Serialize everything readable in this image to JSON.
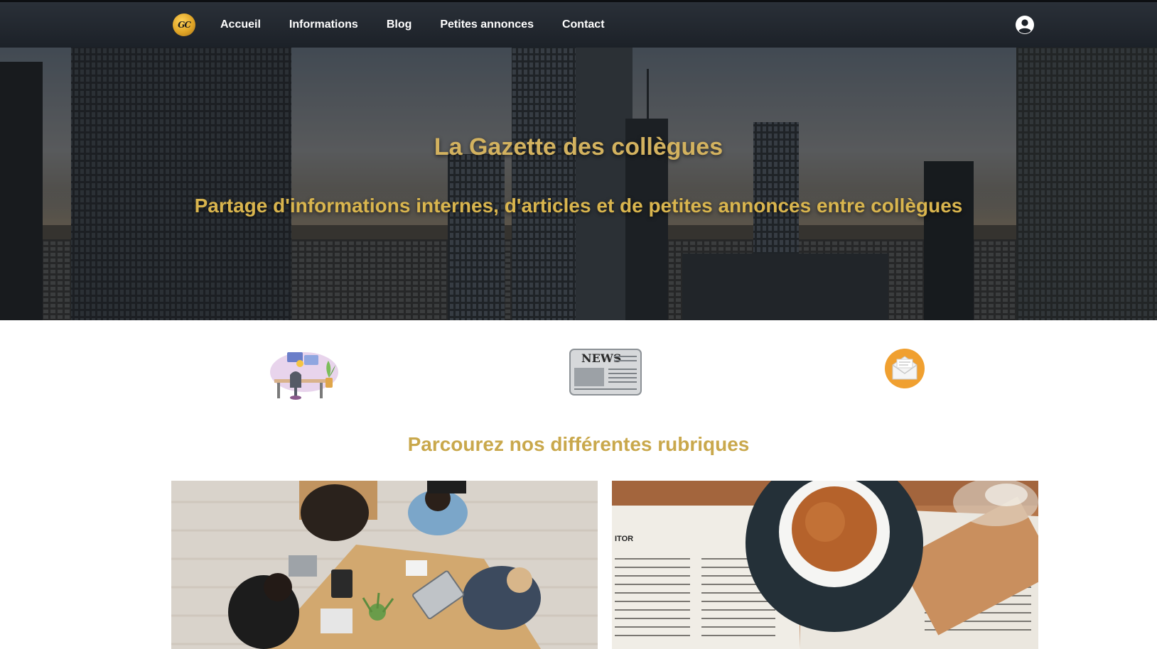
{
  "nav": {
    "logo_text": "GC",
    "links": [
      "Accueil",
      "Informations",
      "Blog",
      "Petites annonces",
      "Contact"
    ],
    "user_icon": "user-circle-icon"
  },
  "hero": {
    "title": "La Gazette des collègues",
    "subtitle": "Partage d'informations internes, d'articles et de petites annonces entre collègues"
  },
  "features": {
    "icons": [
      "office-desk-icon",
      "newspaper-icon",
      "envelope-icon"
    ],
    "news_label": "NEWS"
  },
  "rubriques": {
    "title": "Parcourez nos différentes rubriques",
    "cards": [
      "team-meeting-photo",
      "coffee-newspaper-photo"
    ],
    "newspaper_fragment_text": "ITOR"
  },
  "colors": {
    "accent_gold": "#d3b25f",
    "navbar_bg": "#1c2128"
  }
}
